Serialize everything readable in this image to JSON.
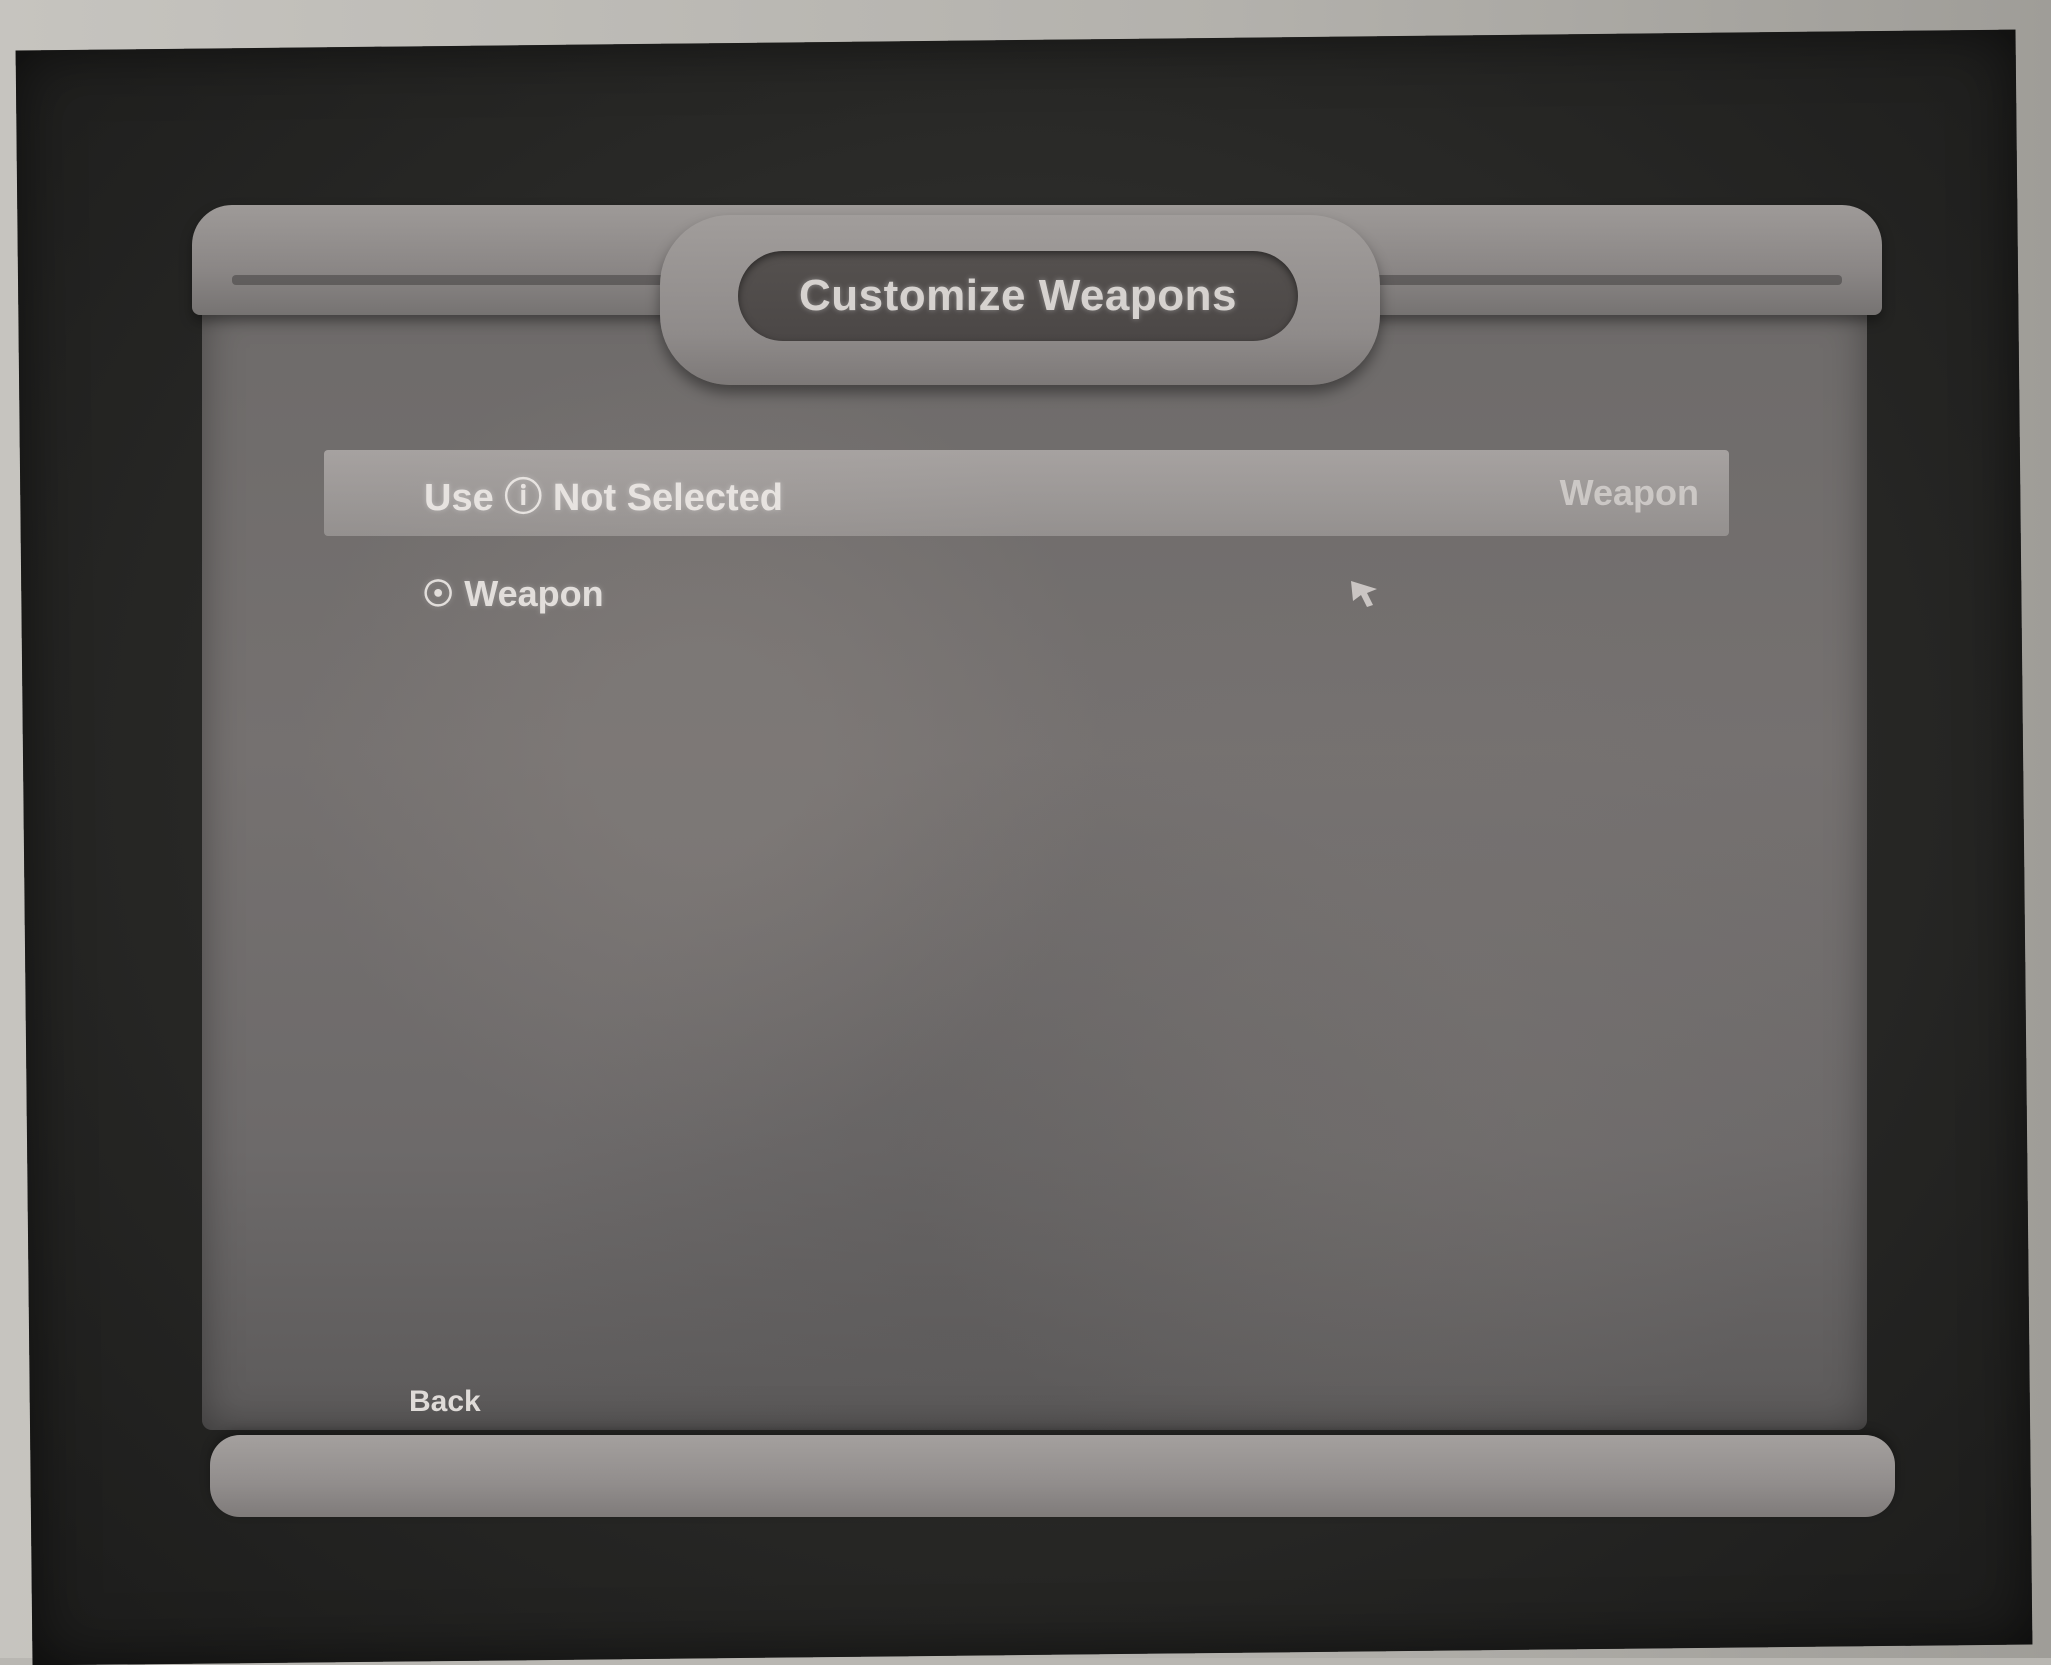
{
  "window": {
    "title": "Customize Weapons"
  },
  "menu": {
    "selected_item": {
      "label": "Use ⓘ Not Selected",
      "value": "Weapon"
    },
    "sub_item": {
      "label": "☉ Weapon"
    }
  },
  "footer": {
    "back_label": "Back"
  }
}
